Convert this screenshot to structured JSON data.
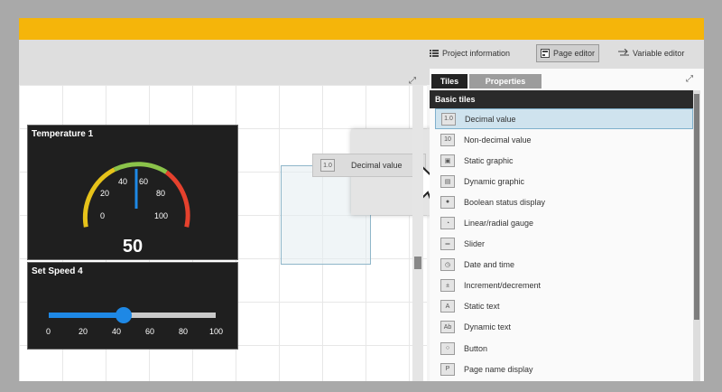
{
  "toolbar": {
    "project_info": "Project information",
    "page_editor": "Page editor",
    "variable_editor": "Variable editor"
  },
  "panel": {
    "tabs": [
      "Tiles",
      "Properties"
    ],
    "section": "Basic tiles",
    "items": [
      {
        "label": "Decimal value",
        "icon": "decimal-value-icon",
        "selected": true
      },
      {
        "label": "Non-decimal value",
        "icon": "non-decimal-value-icon"
      },
      {
        "label": "Static graphic",
        "icon": "static-graphic-icon"
      },
      {
        "label": "Dynamic graphic",
        "icon": "dynamic-graphic-icon"
      },
      {
        "label": "Boolean status display",
        "icon": "boolean-status-icon"
      },
      {
        "label": "Linear/radial gauge",
        "icon": "gauge-icon"
      },
      {
        "label": "Slider",
        "icon": "slider-icon"
      },
      {
        "label": "Date and time",
        "icon": "clock-icon"
      },
      {
        "label": "Increment/decrement",
        "icon": "increment-icon"
      },
      {
        "label": "Static text",
        "icon": "static-text-icon"
      },
      {
        "label": "Dynamic text",
        "icon": "dynamic-text-icon"
      },
      {
        "label": "Button",
        "icon": "button-icon"
      },
      {
        "label": "Page name display",
        "icon": "page-name-icon"
      }
    ]
  },
  "canvas": {
    "temperature_tile": {
      "title": "Temperature 1",
      "value": "50",
      "gauge_level": 0.5,
      "ticks": [
        "0",
        "20",
        "40",
        "60",
        "80",
        "100"
      ]
    },
    "speed_tile": {
      "title": "Set Speed 4",
      "slider_level": 0.45,
      "ticks": [
        "0",
        "20",
        "40",
        "60",
        "80",
        "100"
      ]
    },
    "drag_item": "Decimal value"
  },
  "colors": {
    "topbar": "#f5b50a",
    "accent_blue": "#1e88e5",
    "gauge_green": "#8bc34a",
    "gauge_yellow": "#e6c21a",
    "gauge_red": "#e5412d"
  }
}
